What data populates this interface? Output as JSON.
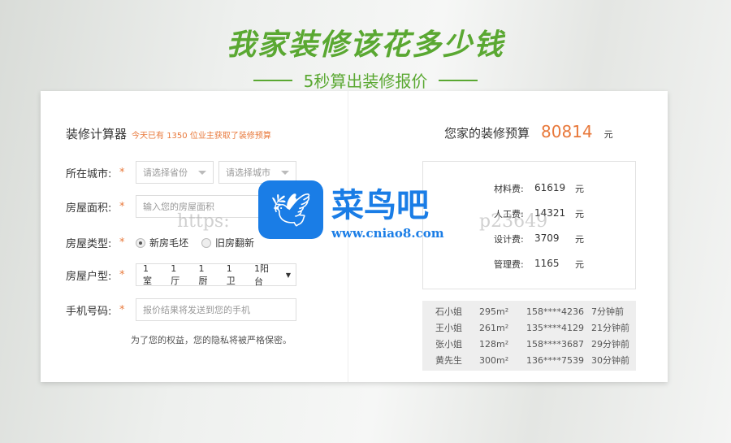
{
  "header": {
    "title": "我家装修该花多少钱",
    "subtitle": "5秒算出装修报价"
  },
  "calculator": {
    "title": "装修计算器",
    "hint": "今天已有 1350 位业主获取了装修预算",
    "city_label": "所在城市:",
    "province_placeholder": "请选择省份",
    "city_placeholder": "请选择城市",
    "area_label": "房屋面积:",
    "area_placeholder": "输入您的房屋面积",
    "type_label": "房屋类型:",
    "type_options": [
      "新房毛坯",
      "旧房翻新"
    ],
    "type_selected": "新房毛坯",
    "layout_label": "房屋户型:",
    "layout": [
      "1室",
      "1厅",
      "1厨",
      "1卫",
      "1阳台"
    ],
    "phone_label": "手机号码:",
    "phone_placeholder": "报价结果将发送到您的手机",
    "privacy": "为了您的权益，您的隐私将被严格保密。",
    "star": "*"
  },
  "budget": {
    "title": "您家的装修预算",
    "total": "80814",
    "unit": "元",
    "fees": [
      {
        "k": "材料费:",
        "v": "61619"
      },
      {
        "k": "人工费:",
        "v": "14321"
      },
      {
        "k": "设计费:",
        "v": "3709"
      },
      {
        "k": "管理费:",
        "v": "1165"
      }
    ]
  },
  "recent": [
    [
      "石小姐",
      "295m²",
      "158****4236",
      "7分钟前"
    ],
    [
      "王小姐",
      "261m²",
      "135****4129",
      "21分钟前"
    ],
    [
      "张小姐",
      "128m²",
      "158****3687",
      "29分钟前"
    ],
    [
      "黄先生",
      "300m²",
      "136****7539",
      "30分钟前"
    ]
  ],
  "watermark": {
    "name": "菜鸟吧",
    "url": "www.cniao8.com",
    "faint1": "https:",
    "faint2": "p23649"
  }
}
